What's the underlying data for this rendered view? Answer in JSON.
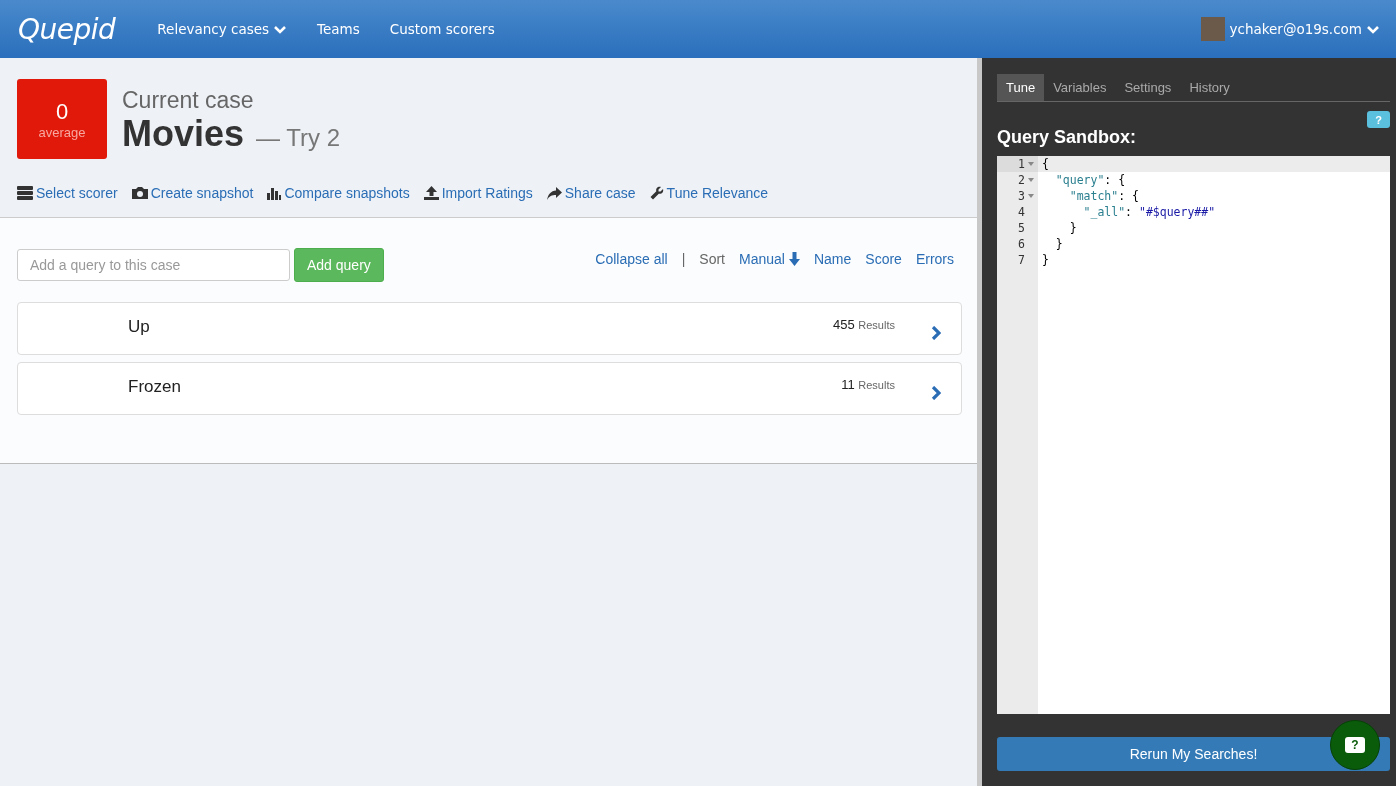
{
  "navbar": {
    "brand": "Quepid",
    "links": [
      {
        "label": "Relevancy cases",
        "dropdown": true
      },
      {
        "label": "Teams",
        "dropdown": false
      },
      {
        "label": "Custom scorers",
        "dropdown": false
      }
    ],
    "user": {
      "email": "ychaker@o19s.com",
      "dropdown": true
    }
  },
  "case": {
    "score": "0",
    "score_label": "average",
    "color": "#e0190a",
    "heading": "Current case",
    "name": "Movies",
    "try": "— Try 2"
  },
  "actions": [
    {
      "kind": "scorer",
      "label": "Select scorer"
    },
    {
      "kind": "camera",
      "label": "Create snapshot"
    },
    {
      "kind": "chart",
      "label": "Compare snapshots"
    },
    {
      "kind": "upload",
      "label": "Import Ratings"
    },
    {
      "kind": "share",
      "label": "Share case"
    },
    {
      "kind": "wrench",
      "label": "Tune Relevance"
    }
  ],
  "add_query": {
    "placeholder": "Add a query to this case",
    "button": "Add query"
  },
  "list_controls": {
    "collapse": "Collapse all",
    "separator": "|",
    "sort_label": "Sort",
    "sorts": [
      {
        "label": "Manual",
        "selected": true
      },
      {
        "label": "Name",
        "selected": false
      },
      {
        "label": "Score",
        "selected": false
      },
      {
        "label": "Errors",
        "selected": false
      }
    ]
  },
  "queries": [
    {
      "query": "Up",
      "count": "455",
      "count_label": "Results"
    },
    {
      "query": "Frozen",
      "count": "11",
      "count_label": "Results"
    }
  ],
  "panel": {
    "tabs": [
      {
        "label": "Tune",
        "selected": true
      },
      {
        "label": "Variables",
        "selected": false
      },
      {
        "label": "Settings",
        "selected": false
      },
      {
        "label": "History",
        "selected": false
      }
    ],
    "title": "Query Sandbox:",
    "help": "?",
    "editor": {
      "lines": [
        {
          "number": "1",
          "text": "{",
          "foldable": true,
          "active": true
        },
        {
          "number": "2",
          "text": "  \"query\": {",
          "foldable": true,
          "active": false
        },
        {
          "number": "3",
          "text": "    \"match\": {",
          "foldable": true,
          "active": false
        },
        {
          "number": "4",
          "text": "      \"_all\": \"#$query##\"",
          "foldable": false,
          "active": false
        },
        {
          "number": "5",
          "text": "    }",
          "foldable": false,
          "active": false
        },
        {
          "number": "6",
          "text": "  }",
          "foldable": false,
          "active": false
        },
        {
          "number": "7",
          "text": "}",
          "foldable": false,
          "active": false
        }
      ]
    },
    "rerun": "Rerun My Searches!",
    "chat": "?"
  }
}
